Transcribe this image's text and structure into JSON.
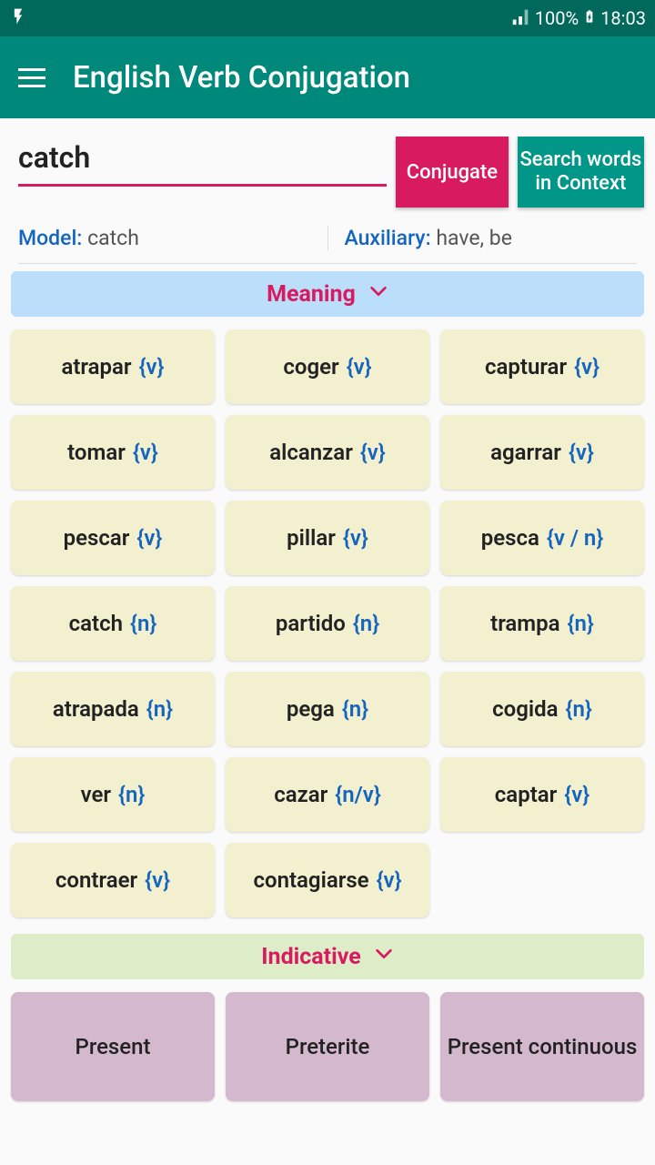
{
  "status": {
    "battery": "100%",
    "time": "18:03"
  },
  "app": {
    "title": "English Verb Conjugation"
  },
  "search": {
    "value": "catch"
  },
  "buttons": {
    "conjugate": "Conjugate",
    "context": "Search words in Context"
  },
  "info": {
    "model_label": "Model:",
    "model_value": " catch",
    "aux_label": "Auxiliary:",
    "aux_value": " have, be"
  },
  "sections": {
    "meaning": "Meaning",
    "indicative": "Indicative"
  },
  "meanings": [
    {
      "word": "atrapar",
      "pos": "{v}"
    },
    {
      "word": "coger",
      "pos": "{v}"
    },
    {
      "word": "capturar",
      "pos": "{v}"
    },
    {
      "word": "tomar",
      "pos": "{v}"
    },
    {
      "word": "alcanzar",
      "pos": "{v}"
    },
    {
      "word": "agarrar",
      "pos": "{v}"
    },
    {
      "word": "pescar",
      "pos": "{v}"
    },
    {
      "word": "pillar",
      "pos": "{v}"
    },
    {
      "word": "pesca",
      "pos": "{v / n}"
    },
    {
      "word": "catch",
      "pos": "{n}"
    },
    {
      "word": "partido",
      "pos": "{n}"
    },
    {
      "word": "trampa",
      "pos": "{n}"
    },
    {
      "word": "atrapada",
      "pos": "{n}"
    },
    {
      "word": "pega",
      "pos": "{n}"
    },
    {
      "word": "cogida",
      "pos": "{n}"
    },
    {
      "word": "ver",
      "pos": "{n}"
    },
    {
      "word": "cazar",
      "pos": "{n/v}"
    },
    {
      "word": "captar",
      "pos": "{v}"
    },
    {
      "word": "contraer",
      "pos": "{v}"
    },
    {
      "word": "contagiarse",
      "pos": "{v}"
    }
  ],
  "tenses": [
    {
      "label": "Present"
    },
    {
      "label": "Preterite"
    },
    {
      "label": "Present continuous"
    }
  ]
}
